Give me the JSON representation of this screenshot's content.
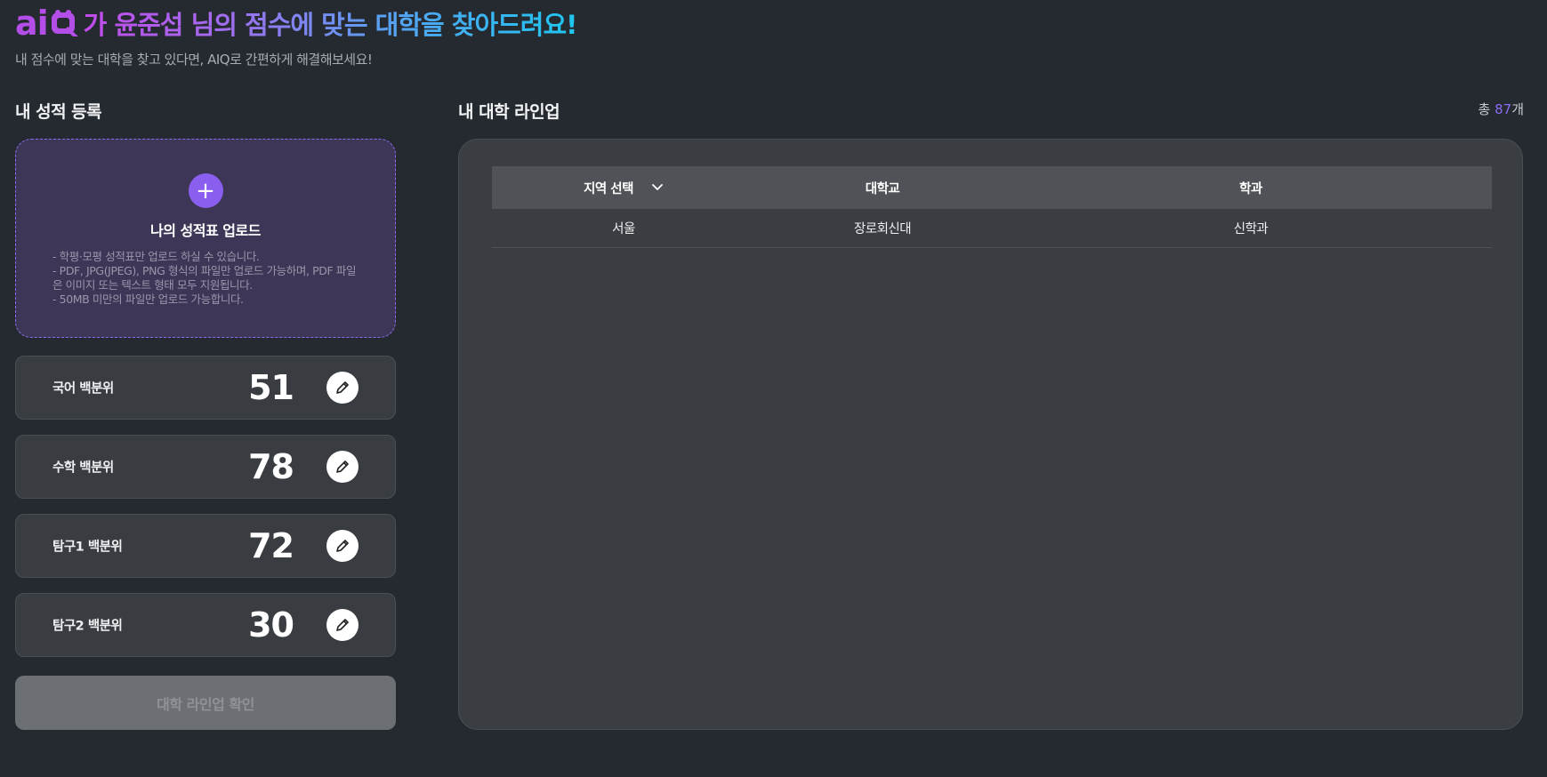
{
  "header": {
    "logo_text": "ai",
    "headline": "가 윤준섭 님의 점수에 맞는 대학을 찾아드려요!",
    "subtitle": "내 점수에 맞는 대학을 찾고 있다면, AIQ로 간편하게 해결해보세요!"
  },
  "left": {
    "title": "내 성적 등록",
    "upload": {
      "plus": "+",
      "title": "나의 성적표 업로드",
      "notes": [
        "- 학평·모평 성적표만 업로드 하실 수 있습니다.",
        "- PDF, JPG(JPEG), PNG 형식의 파일만 업로드 가능하며, PDF 파일은 이미지 또는 텍스트 형태 모두 지원됩니다.",
        "- 50MB 미만의 파일만 업로드 가능합니다."
      ]
    },
    "scores": [
      {
        "label": "국어 백분위",
        "value": "51"
      },
      {
        "label": "수학 백분위",
        "value": "78"
      },
      {
        "label": "탐구1 백분위",
        "value": "72"
      },
      {
        "label": "탐구2 백분위",
        "value": "30"
      }
    ],
    "confirm_label": "대학 라인업 확인"
  },
  "right": {
    "title": "내 대학 라인업",
    "total_prefix": "총 ",
    "total_count": "87",
    "total_suffix": "개",
    "table": {
      "headers": {
        "region": "지역 선택",
        "university": "대학교",
        "department": "학과"
      },
      "rows": [
        {
          "region": "서울",
          "university": "장로회신대",
          "department": "신학과"
        }
      ]
    }
  },
  "colors": {
    "background": "#252a31",
    "accent_purple": "#8a5ff0",
    "logo_purple": "#b44ee8",
    "headline_cyan": "#1fc6f0"
  }
}
